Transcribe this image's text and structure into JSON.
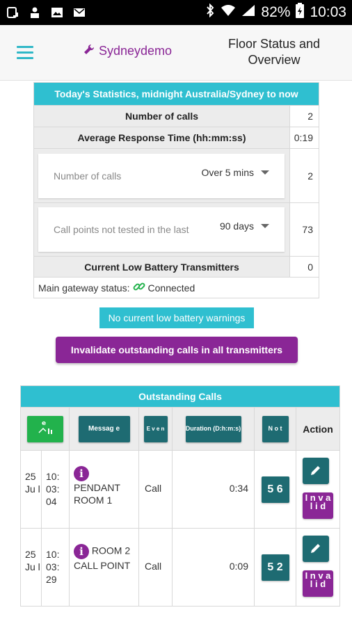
{
  "statusbar": {
    "battery": "82%",
    "time": "10:03"
  },
  "header": {
    "brand": "Sydneydemo",
    "title": "Floor Status and Overview"
  },
  "stats": {
    "heading": "Today's Statistics, midnight Australia/Sydney to now",
    "rows": [
      {
        "label": "Number of calls",
        "value": "2"
      },
      {
        "label": "Average Response Time (hh:mm:ss)",
        "value": "0:19"
      }
    ],
    "calls_over": {
      "label": "Number of calls",
      "selected": "Over 5 mins",
      "value": "2"
    },
    "not_tested": {
      "label": "Call points not tested in the last",
      "selected": "90 days",
      "value": "73"
    },
    "low_battery": {
      "label": "Current Low Battery Transmitters",
      "value": "0"
    },
    "gateway": {
      "label": "Main gateway status:",
      "status": "Connected"
    }
  },
  "notice": "No current low battery warnings",
  "invalidate_label": "Invalidate outstanding calls in all transmitters",
  "outstanding": {
    "heading": "Outstanding Calls",
    "columns": {
      "message": "Messag e",
      "event": "E v e n",
      "duration": "Duration (D:h:m:s)",
      "notify": "N o t",
      "action": "Action"
    },
    "rows": [
      {
        "date": "25 Ju l",
        "time": "10: 03: 04",
        "message": "PENDANT ROOM 1",
        "event": "Call",
        "duration": "0:34",
        "notify": "5 6",
        "invalidate": "I n v a l i d"
      },
      {
        "date": "25 Ju l",
        "time": "10: 03: 29",
        "message": "ROOM 2 CALL POINT",
        "event": "Call",
        "duration": "0:09",
        "notify": "5 2",
        "invalidate": "I n v a l i d"
      }
    ]
  },
  "colors": {
    "teal": "#2fbfd0",
    "purple": "#8a2696",
    "dark_teal": "#1e6b72",
    "green": "#22b24c"
  }
}
